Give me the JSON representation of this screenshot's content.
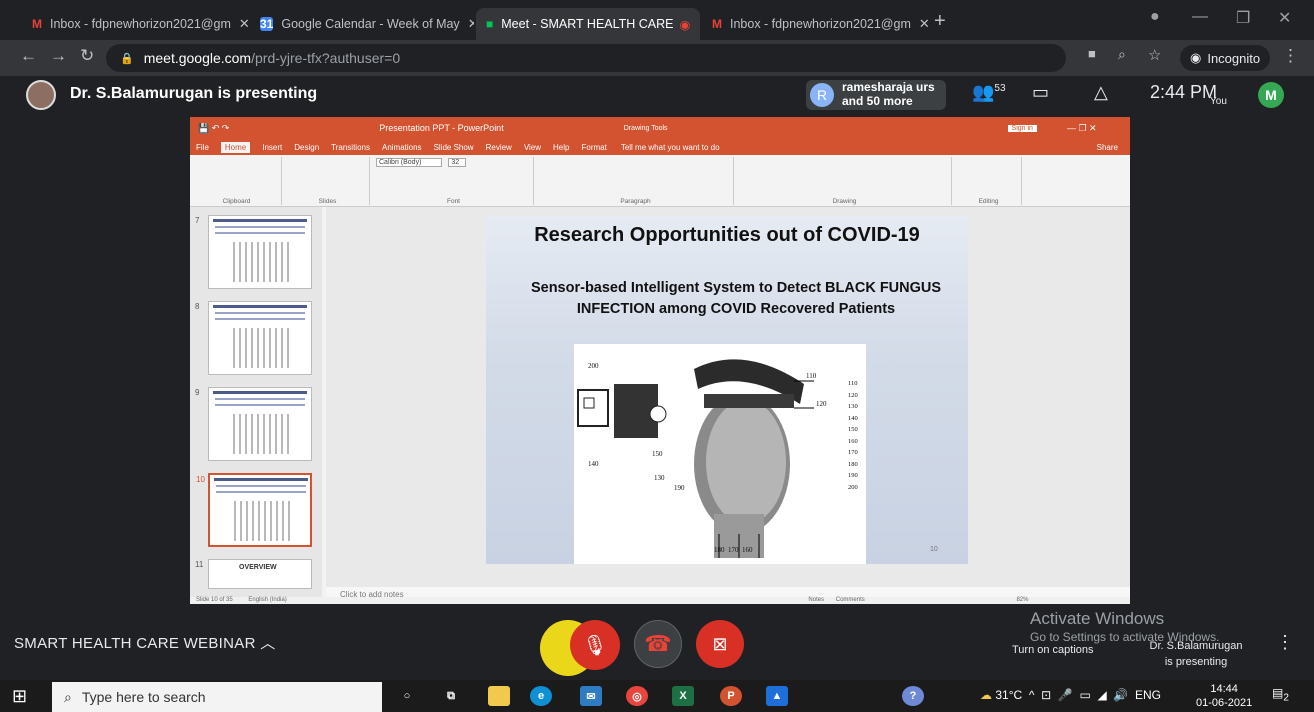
{
  "browser": {
    "tabs": [
      {
        "title": "Inbox - fdpnewhorizon2021@gm",
        "icon": "gmail-icon",
        "color": "#ea4335"
      },
      {
        "title": "Google Calendar - Week of May",
        "icon": "calendar-icon",
        "color": "#4285f4"
      },
      {
        "title": "Meet - SMART HEALTH CARE",
        "icon": "meet-icon",
        "color": "#00832d"
      },
      {
        "title": "Inbox - fdpnewhorizon2021@gm",
        "icon": "gmail-icon",
        "color": "#ea4335"
      }
    ],
    "active_tab": 2,
    "new_tab": "+",
    "url_host": "meet.google.com",
    "url_path": "/prd-yjre-tfx?authuser=0",
    "incognito_label": "Incognito"
  },
  "meet": {
    "presenter_text": "Dr. S.Balamurugan is presenting",
    "participant_initial": "R",
    "participant_line1": "ramesharaja urs",
    "participant_line2": "and 50 more",
    "people_count": "53",
    "time": "2:44 PM",
    "you_label": "You",
    "self_initial": "M",
    "meeting_name": "SMART HEALTH CARE WEBINAR",
    "activate_line1": "Activate Windows",
    "activate_line2": "Go to Settings to activate Windows.",
    "captions_label": "Turn on captions",
    "presenting_line1": "Dr. S.Balamurugan",
    "presenting_line2": "is presenting"
  },
  "powerpoint": {
    "title": "Presentation PPT - PowerPoint",
    "context_tab": "Drawing Tools",
    "sign_in": "Sign in",
    "share": "Share",
    "tabs": [
      "File",
      "Home",
      "Insert",
      "Design",
      "Transitions",
      "Animations",
      "Slide Show",
      "Review",
      "View",
      "Help",
      "Format"
    ],
    "tell_me": "Tell me what you want to do",
    "ribbon_groups": [
      "Clipboard",
      "Slides",
      "Font",
      "Paragraph",
      "Drawing",
      "Editing"
    ],
    "font_name": "Calibri (Body)",
    "font_size": "32",
    "thumb_numbers": [
      "7",
      "8",
      "9",
      "10",
      "11"
    ],
    "thumb11_title": "OVERVIEW",
    "notes_placeholder": "Click to add notes",
    "status_left": "Slide 10 of 35",
    "status_lang": "English (India)",
    "status_notes": "Notes",
    "status_comments": "Comments",
    "zoom": "82%"
  },
  "slide": {
    "title": "Research Opportunities out of COVID-19",
    "subtitle": "Sensor-based Intelligent System to Detect BLACK FUNGUS INFECTION among COVID Recovered Patients",
    "labels_right": [
      "110",
      "120",
      "130",
      "140",
      "150",
      "160",
      "170",
      "180",
      "190",
      "200"
    ],
    "labels_bottom": [
      "180",
      "170",
      "160"
    ],
    "labels_fig": [
      "200",
      "110",
      "120",
      "140",
      "150",
      "130",
      "190"
    ],
    "page_num": "10"
  },
  "taskbar": {
    "search_placeholder": "Type here to search",
    "temp": "31°C",
    "lang": "ENG",
    "time": "14:44",
    "date": "01-06-2021",
    "notif_count": "2"
  }
}
